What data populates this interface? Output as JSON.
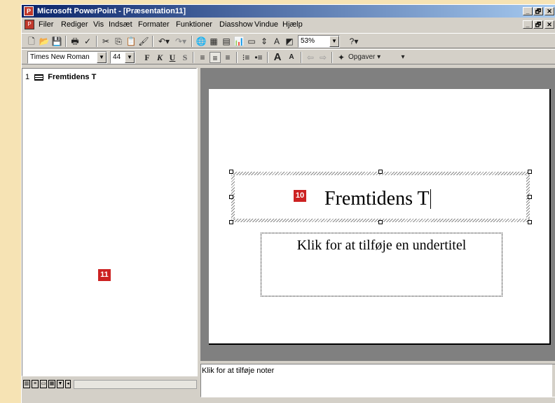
{
  "window": {
    "title": "Microsoft PowerPoint - [Præsentation11]",
    "app_icon": "powerpoint-icon",
    "controls": [
      "_",
      "🗗",
      "✕"
    ]
  },
  "menu": {
    "items": [
      "Filer",
      "Rediger",
      "Vis",
      "Indsæt",
      "Formater",
      "Funktioner",
      "Diasshow",
      "Vindue",
      "Hjælp"
    ]
  },
  "standard_toolbar": {
    "zoom": "53%",
    "help_symbol": "?"
  },
  "format_toolbar": {
    "font_name": "Times New Roman",
    "font_size": "44",
    "bold": "F",
    "italic": "K",
    "underline": "U",
    "shadow": "S",
    "grow_font": "A",
    "shrink_font": "A",
    "tasks_label": "Opgaver ▾"
  },
  "outline": {
    "slides": [
      {
        "number": "1",
        "title": "Fremtidens T"
      }
    ]
  },
  "slide": {
    "title": "Fremtidens T",
    "subtitle_placeholder": "Klik for at tilføje en undertitel"
  },
  "notes": {
    "placeholder": "Klik for at tilføje noter"
  },
  "callouts": {
    "title_badge": "10",
    "outline_badge": "11"
  },
  "colors": {
    "title_bar_start": "#0a246a",
    "title_bar_end": "#a6caf0",
    "chrome": "#d4d0c8",
    "page_background": "#f6e3b4",
    "slide_workspace": "#808080",
    "callout_badge": "#cc2222"
  }
}
